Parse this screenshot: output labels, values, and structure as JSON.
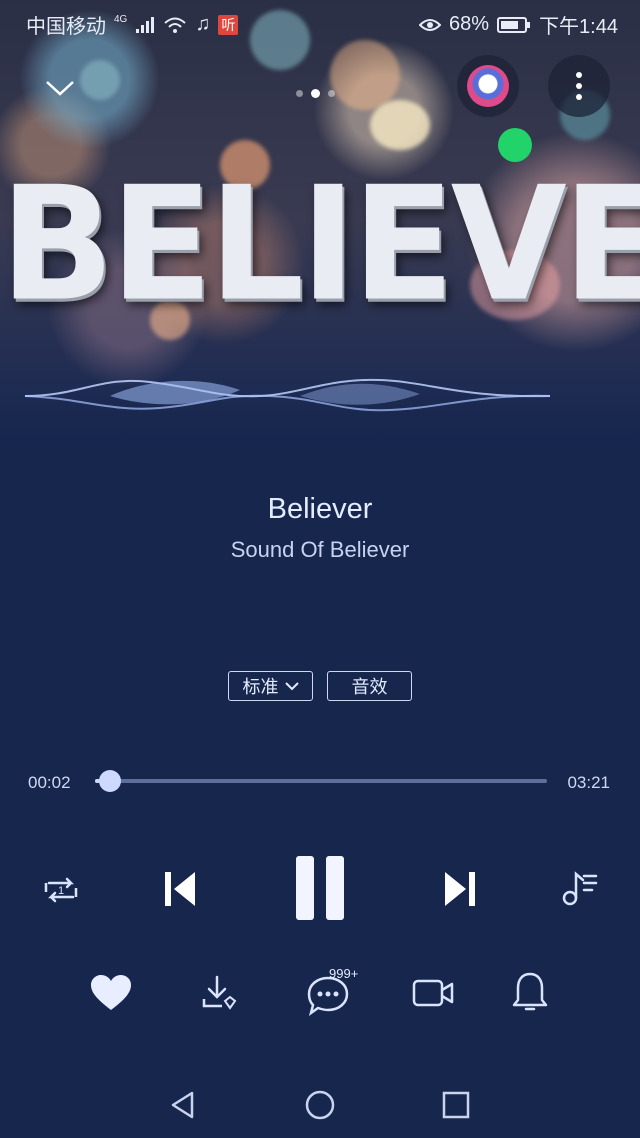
{
  "status_bar": {
    "carrier": "中国移动",
    "network": "4G",
    "badge": "听",
    "battery": "68%",
    "time": "下午1:44"
  },
  "header": {
    "collapse_icon": "chevron-down-icon",
    "page_count": 3,
    "active_page": 2,
    "more_icon": "more-vertical-icon"
  },
  "cover": {
    "art_text": "BELIEVER"
  },
  "song": {
    "title": "Believer",
    "artist": "Sound Of Believer"
  },
  "options": {
    "quality_label": "标准",
    "effects_label": "音效"
  },
  "progress": {
    "current": "00:02",
    "total": "03:21",
    "fraction": 0.01
  },
  "controls": {
    "repeat_count": "1",
    "play_state": "playing"
  },
  "actions": {
    "comment_count": "999+"
  },
  "colors": {
    "background": "#16264d",
    "accent": "#cdd9ff"
  }
}
